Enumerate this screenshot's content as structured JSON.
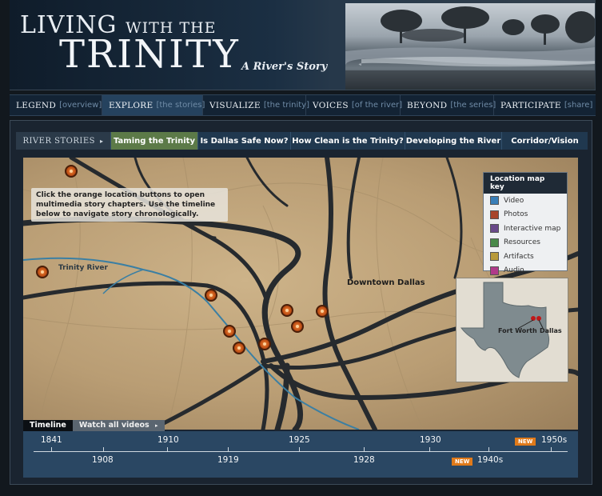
{
  "header": {
    "title_line1": "LIVING",
    "title_line1_small": "WITH THE",
    "title_line2": "TRINITY",
    "tagline": "A River's Story"
  },
  "main_nav": [
    {
      "label": "LEGEND",
      "sub": "[overview]",
      "active": false
    },
    {
      "label": "EXPLORE",
      "sub": "[the stories]",
      "active": true
    },
    {
      "label": "VISUALIZE",
      "sub": "[the trinity]",
      "active": false
    },
    {
      "label": "VOICES",
      "sub": "[of the river]",
      "active": false
    },
    {
      "label": "BEYOND",
      "sub": "[the series]",
      "active": false
    },
    {
      "label": "PARTICIPATE",
      "sub": "[share]",
      "active": false
    }
  ],
  "story_nav": {
    "label": "RIVER STORIES",
    "arrow": "▸",
    "items": [
      {
        "label": "Taming the Trinity",
        "active": true
      },
      {
        "label": "Is Dallas Safe Now?",
        "active": false
      },
      {
        "label": "How Clean is the Trinity?",
        "active": false
      },
      {
        "label": "Developing the River",
        "active": false
      },
      {
        "label": "Corridor/Vision",
        "active": false
      }
    ]
  },
  "map": {
    "instructions": "Click the orange location buttons to open multimedia story chapters. Use the timeline below to navigate story chronologically.",
    "river_label": "Trinity River",
    "city_label": "Downtown Dallas",
    "key": {
      "title": "Location map key",
      "items": [
        {
          "label": "Video",
          "color": "#3a7fb8"
        },
        {
          "label": "Photos",
          "color": "#a8442a"
        },
        {
          "label": "Interactive map",
          "color": "#6a4a8a"
        },
        {
          "label": "Resources",
          "color": "#4a8a4a"
        },
        {
          "label": "Artifacts",
          "color": "#b89a3a"
        },
        {
          "label": "Audio",
          "color": "#b03a8a"
        }
      ]
    },
    "inset": {
      "label_fort_worth": "Fort Worth",
      "label_dallas": "Dallas"
    }
  },
  "timeline": {
    "tab_timeline": "Timeline",
    "tab_videos": "Watch all videos",
    "tab_videos_arrow": "▸",
    "years_top": [
      "1841",
      "1910",
      "1925",
      "1930",
      "1950s"
    ],
    "years_bottom": [
      "1908",
      "1919",
      "1928",
      "1940s"
    ],
    "new_badge": "NEW"
  }
}
